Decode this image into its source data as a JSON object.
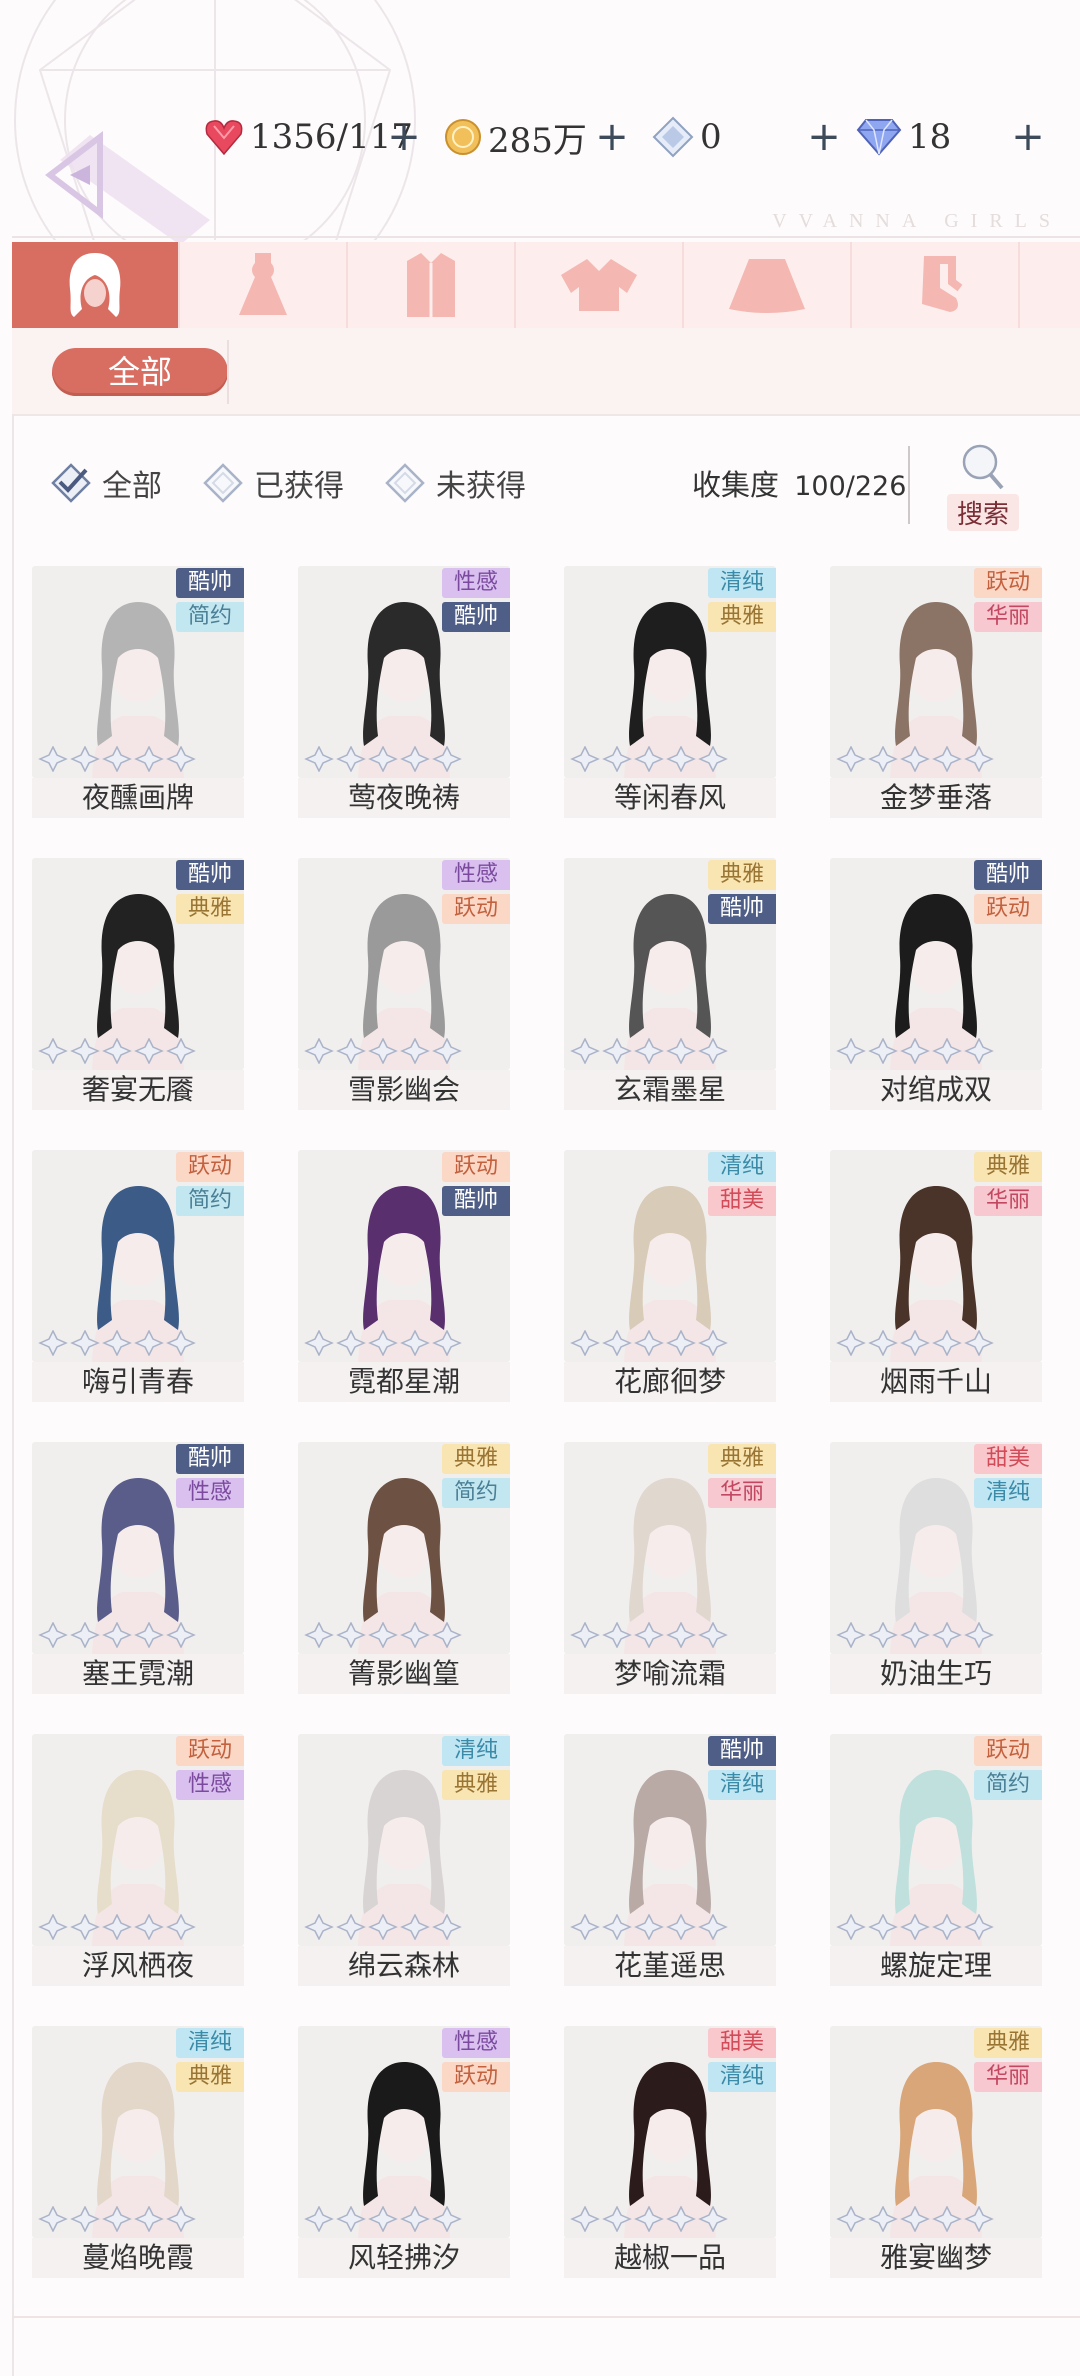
{
  "header": {
    "stamina": "1356/117",
    "gold": "285万",
    "crystal": "0",
    "diamond": "18",
    "brand": "VVANNA GIRLS"
  },
  "categories": [
    "hair-icon",
    "dress-icon",
    "coat-icon",
    "top-icon",
    "skirt-icon",
    "socks-icon",
    "more-icon"
  ],
  "sub": {
    "all_label": "全部"
  },
  "filter": {
    "all_label": "全部",
    "obtained_label": "已获得",
    "not_obtained_label": "未获得",
    "collect_label": "收集度",
    "collect_value": "100/226",
    "search_label": "搜索"
  },
  "items": [
    {
      "name": "夜醺画牌",
      "tags": [
        "酷帅",
        "简约"
      ]
    },
    {
      "name": "莺夜晚祷",
      "tags": [
        "性感",
        "酷帅"
      ]
    },
    {
      "name": "等闲春风",
      "tags": [
        "清纯",
        "典雅"
      ]
    },
    {
      "name": "金梦垂落",
      "tags": [
        "跃动",
        "华丽"
      ]
    },
    {
      "name": "奢宴无餍",
      "tags": [
        "酷帅",
        "典雅"
      ]
    },
    {
      "name": "雪影幽会",
      "tags": [
        "性感",
        "跃动"
      ]
    },
    {
      "name": "玄霜墨星",
      "tags": [
        "典雅",
        "酷帅"
      ]
    },
    {
      "name": "对绾成双",
      "tags": [
        "酷帅",
        "跃动"
      ]
    },
    {
      "name": "嗨引青春",
      "tags": [
        "跃动",
        "简约"
      ]
    },
    {
      "name": "霓都星潮",
      "tags": [
        "跃动",
        "酷帅"
      ]
    },
    {
      "name": "花廊徊梦",
      "tags": [
        "清纯",
        "甜美"
      ]
    },
    {
      "name": "烟雨千山",
      "tags": [
        "典雅",
        "华丽"
      ]
    },
    {
      "name": "塞王霓潮",
      "tags": [
        "酷帅",
        "性感"
      ]
    },
    {
      "name": "箐影幽篁",
      "tags": [
        "典雅",
        "简约"
      ]
    },
    {
      "name": "梦喻流霜",
      "tags": [
        "典雅",
        "华丽"
      ]
    },
    {
      "name": "奶油生巧",
      "tags": [
        "甜美",
        "清纯"
      ]
    },
    {
      "name": "浮风栖夜",
      "tags": [
        "跃动",
        "性感"
      ]
    },
    {
      "name": "绵云森林",
      "tags": [
        "清纯",
        "典雅"
      ]
    },
    {
      "name": "花堇遥思",
      "tags": [
        "酷帅",
        "清纯"
      ]
    },
    {
      "name": "螺旋定理",
      "tags": [
        "跃动",
        "简约"
      ]
    },
    {
      "name": "蔓焰晚霞",
      "tags": [
        "清纯",
        "典雅"
      ]
    },
    {
      "name": "风轻拂汐",
      "tags": [
        "性感",
        "跃动"
      ]
    },
    {
      "name": "越椒一品",
      "tags": [
        "甜美",
        "清纯"
      ]
    },
    {
      "name": "雅宴幽梦",
      "tags": [
        "典雅",
        "华丽"
      ]
    }
  ],
  "hair_colors": [
    "#b4b4b4",
    "#2a2a2a",
    "#1e1e1e",
    "#8b7466",
    "#222",
    "#9a9a9a",
    "#555",
    "#1c1c1c",
    "#3d5b87",
    "#5a2f6e",
    "#d8cbb8",
    "#4a3429",
    "#5a5d8a",
    "#6d5244",
    "#e0d7cf",
    "#dedede",
    "#e6decb",
    "#d8d4d4",
    "#b9aaa6",
    "#bfe0dc",
    "#e2d7c9",
    "#1a1a1a",
    "#2c1b1b",
    "#d8a678"
  ]
}
